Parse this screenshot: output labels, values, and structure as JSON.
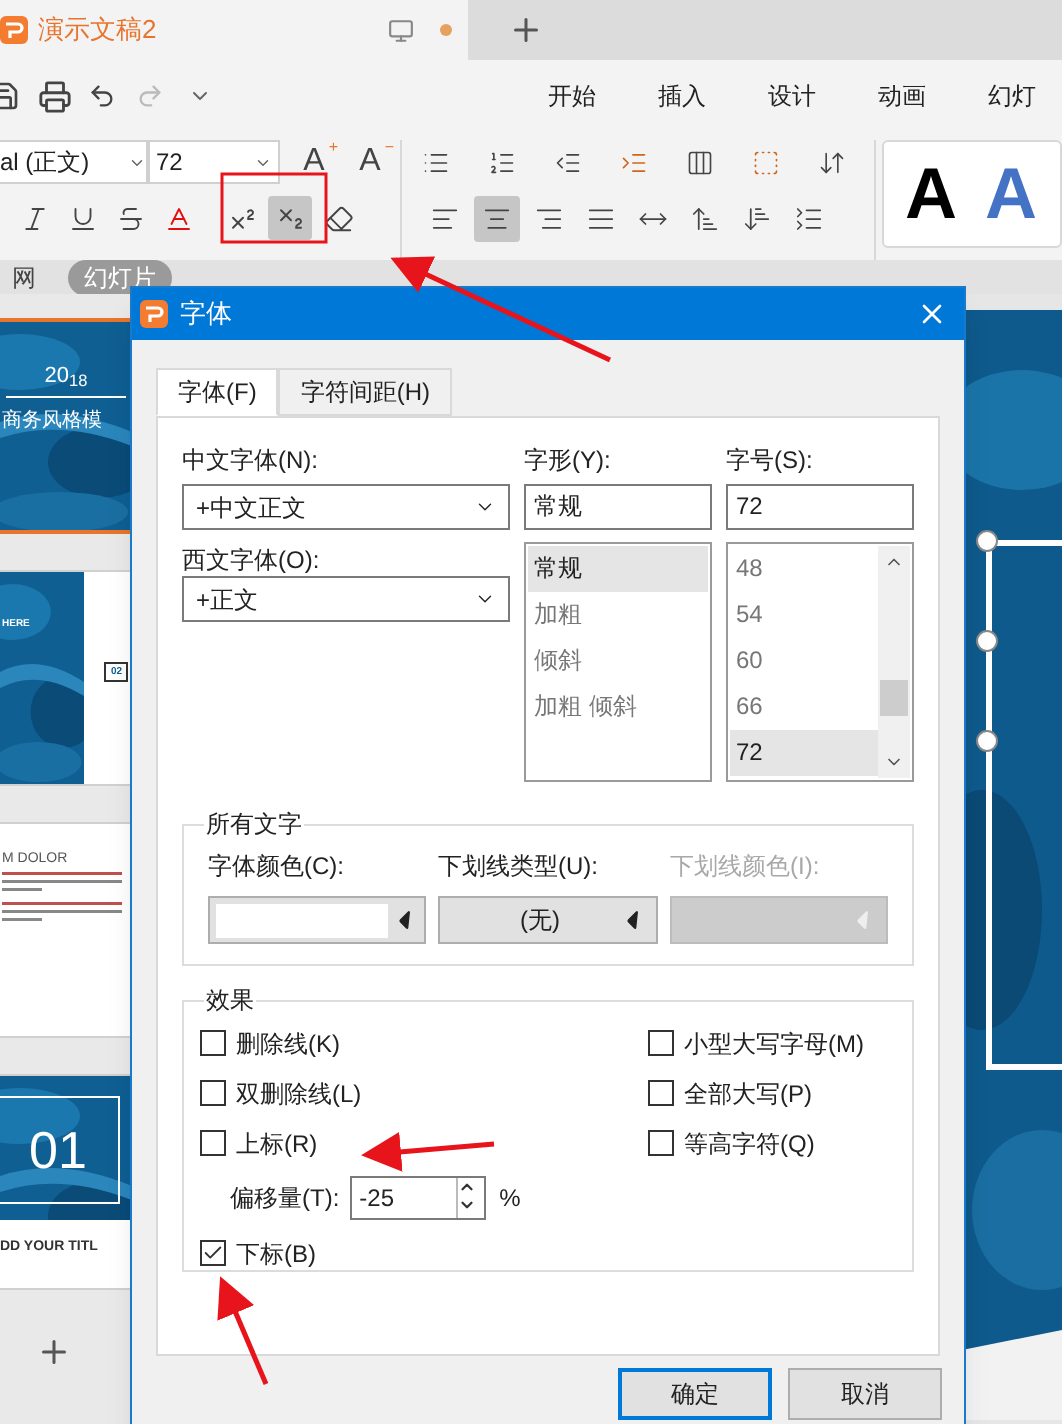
{
  "document_tab": {
    "title": "演示文稿2",
    "unsaved": true
  },
  "ribbon_tabs": [
    {
      "label": "开始"
    },
    {
      "label": "插入"
    },
    {
      "label": "设计"
    },
    {
      "label": "动画"
    },
    {
      "label": "幻灯"
    }
  ],
  "font_box": {
    "font": "al (正文)",
    "size": "72"
  },
  "size_buttons": [
    {
      "text": "A",
      "sign": "+"
    },
    {
      "text": "A",
      "sign": "−"
    }
  ],
  "format_buttons": [
    {
      "kind": "italic",
      "pressed": false
    },
    {
      "kind": "underline",
      "pressed": false
    },
    {
      "kind": "strikethrough",
      "pressed": false
    },
    {
      "kind": "font_color",
      "pressed": false
    },
    {
      "kind": "superscript",
      "pressed": false
    },
    {
      "kind": "subscript",
      "pressed": true
    },
    {
      "kind": "clear",
      "pressed": false
    }
  ],
  "list_buttons": [
    {
      "kind": "bullets"
    },
    {
      "kind": "numbering"
    },
    {
      "kind": "outdent"
    },
    {
      "kind": "indent"
    },
    {
      "kind": "columns"
    },
    {
      "kind": "textbox"
    },
    {
      "kind": "direction"
    }
  ],
  "paragraph_buttons": [
    {
      "kind": "align_left",
      "pressed": false
    },
    {
      "kind": "align_center",
      "pressed": true
    },
    {
      "kind": "align_right",
      "pressed": false
    },
    {
      "kind": "justify",
      "pressed": false
    },
    {
      "kind": "distribute",
      "pressed": false
    },
    {
      "kind": "spacing_up",
      "pressed": false
    },
    {
      "kind": "spacing_down",
      "pressed": false
    },
    {
      "kind": "line_spacing",
      "pressed": false
    }
  ],
  "style_samples": [
    {
      "text": "A",
      "color": "#000000"
    },
    {
      "text": "A",
      "color": "#4472c4"
    }
  ],
  "panel_tabs": [
    {
      "label": "网",
      "selected": false
    },
    {
      "label": "幻灯片",
      "selected": true
    }
  ],
  "slides": [
    {
      "kind": "title",
      "selected": true,
      "heading": "20$_{18}$",
      "subtitle": "商务风格模"
    },
    {
      "kind": "split",
      "selected": false,
      "heading": "HERE",
      "number": "02"
    },
    {
      "kind": "text",
      "selected": false,
      "heading": "M DOLOR"
    },
    {
      "kind": "number",
      "selected": false,
      "number": "01",
      "heading": "DD YOUR TITL"
    }
  ],
  "dialog": {
    "title": "字体",
    "tabs": [
      {
        "label": "字体(F)",
        "selected": true
      },
      {
        "label": "字符间距(H)",
        "selected": false
      }
    ],
    "chinese_font": {
      "label": "中文字体(N):",
      "value": "+中文正文"
    },
    "western_font": {
      "label": "西文字体(O):",
      "value": "+正文"
    },
    "style": {
      "label": "字形(Y):",
      "value": "常规",
      "options": [
        {
          "label": "常规",
          "selected": true
        },
        {
          "label": "加粗",
          "selected": false
        },
        {
          "label": "倾斜",
          "selected": false
        },
        {
          "label": "加粗 倾斜",
          "selected": false
        }
      ]
    },
    "size": {
      "label": "字号(S):",
      "value": "72",
      "options": [
        {
          "label": "48",
          "selected": false
        },
        {
          "label": "54",
          "selected": false
        },
        {
          "label": "60",
          "selected": false
        },
        {
          "label": "66",
          "selected": false
        },
        {
          "label": "72",
          "selected": true
        }
      ]
    },
    "all_text": {
      "title": "所有文字",
      "font_color": {
        "label": "字体颜色(C):",
        "color": "#ffffff"
      },
      "underline_type": {
        "label": "下划线类型(U):",
        "value": "(无)"
      },
      "underline_color": {
        "label": "下划线颜色(I):",
        "disabled": true
      }
    },
    "effects": {
      "title": "效果",
      "left": [
        {
          "kind": "checkbox",
          "label": "删除线(K)",
          "checked": false
        },
        {
          "kind": "checkbox",
          "label": "双删除线(L)",
          "checked": false
        },
        {
          "kind": "checkbox",
          "label": "上标(R)",
          "checked": false
        },
        {
          "kind": "offset",
          "label": "偏移量(T):",
          "value": "-25",
          "unit": "%"
        },
        {
          "kind": "checkbox",
          "label": "下标(B)",
          "checked": true
        }
      ],
      "right": [
        {
          "kind": "checkbox",
          "label": "小型大写字母(M)",
          "checked": false
        },
        {
          "kind": "checkbox",
          "label": "全部大写(P)",
          "checked": false
        },
        {
          "kind": "checkbox",
          "label": "等高字符(Q)",
          "checked": false
        }
      ]
    },
    "buttons": [
      {
        "label": "确定",
        "default": true
      },
      {
        "label": "取消",
        "default": false
      }
    ]
  }
}
